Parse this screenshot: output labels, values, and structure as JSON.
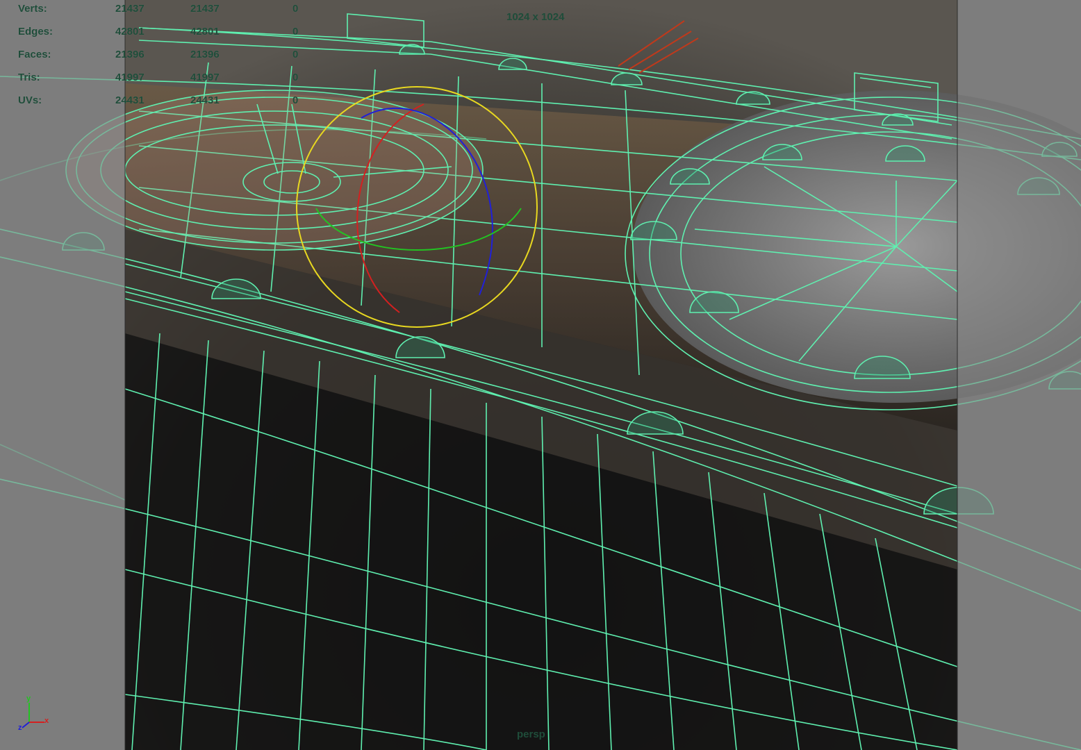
{
  "hud": {
    "rows": [
      {
        "label": "Verts:",
        "col1": "21437",
        "col2": "21437",
        "col3": "0"
      },
      {
        "label": "Edges:",
        "col1": "42801",
        "col2": "42801",
        "col3": "0"
      },
      {
        "label": "Faces:",
        "col1": "21396",
        "col2": "21396",
        "col3": "0"
      },
      {
        "label": "Tris:",
        "col1": "41997",
        "col2": "41997",
        "col3": "0"
      },
      {
        "label": "UVs:",
        "col1": "24431",
        "col2": "24431",
        "col3": "0"
      }
    ]
  },
  "resolution_gate_label": "1024 x 1024",
  "camera_name": "persp",
  "axis_indicator": {
    "x": "x",
    "y": "y",
    "z": "z"
  },
  "colors": {
    "wireframe": "#5ff0b0",
    "hud_text": "#1f4d3a",
    "gate_mask": "#7a7a7a",
    "rotate_x": "#d42020",
    "rotate_y": "#22c422",
    "rotate_z": "#2020d8",
    "rotate_view": "#e8d820"
  },
  "icons": [
    "rotate-manipulator-icon",
    "axis-indicator-icon",
    "light-icon"
  ]
}
